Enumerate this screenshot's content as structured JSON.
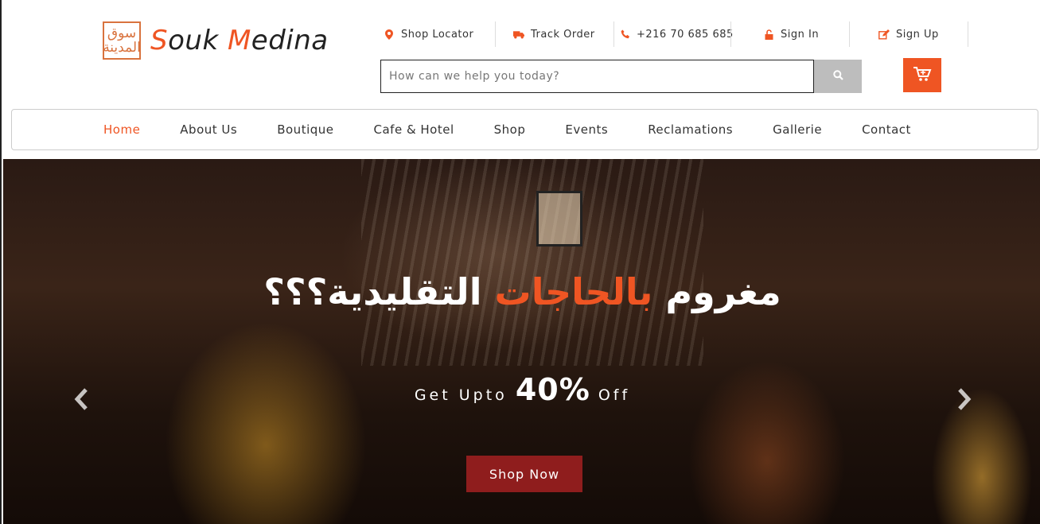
{
  "header": {
    "logo_mark": "سوق المدينة",
    "brand_first_initial": "S",
    "brand_first_rest": "ouk ",
    "brand_second_initial": "M",
    "brand_second_rest": "edina"
  },
  "top_links": [
    {
      "label": "Shop Locator",
      "icon": "map-marker-icon"
    },
    {
      "label": "Track Order",
      "icon": "truck-icon"
    },
    {
      "label": "+216 70 685 685",
      "icon": "phone-icon"
    },
    {
      "label": "Sign In",
      "icon": "unlock-icon"
    },
    {
      "label": "Sign Up",
      "icon": "edit-icon"
    }
  ],
  "search": {
    "placeholder": "How can we help you today?"
  },
  "nav": {
    "items": [
      "Home",
      "About Us",
      "Boutique",
      "Cafe & Hotel",
      "Shop",
      "Events",
      "Reclamations",
      "Gallerie",
      "Contact"
    ],
    "active": "Home"
  },
  "hero": {
    "title_start": "مغروم ",
    "title_accent": "بالحاجات",
    "title_end": " التقليدية؟؟؟",
    "sub_prefix": "Get Upto ",
    "sub_big": "40%",
    "sub_suffix": " Off",
    "cta": "Shop Now"
  },
  "colors": {
    "accent": "#ef5523",
    "cta": "#8f1d1d",
    "search_button": "#bdbdbd"
  }
}
